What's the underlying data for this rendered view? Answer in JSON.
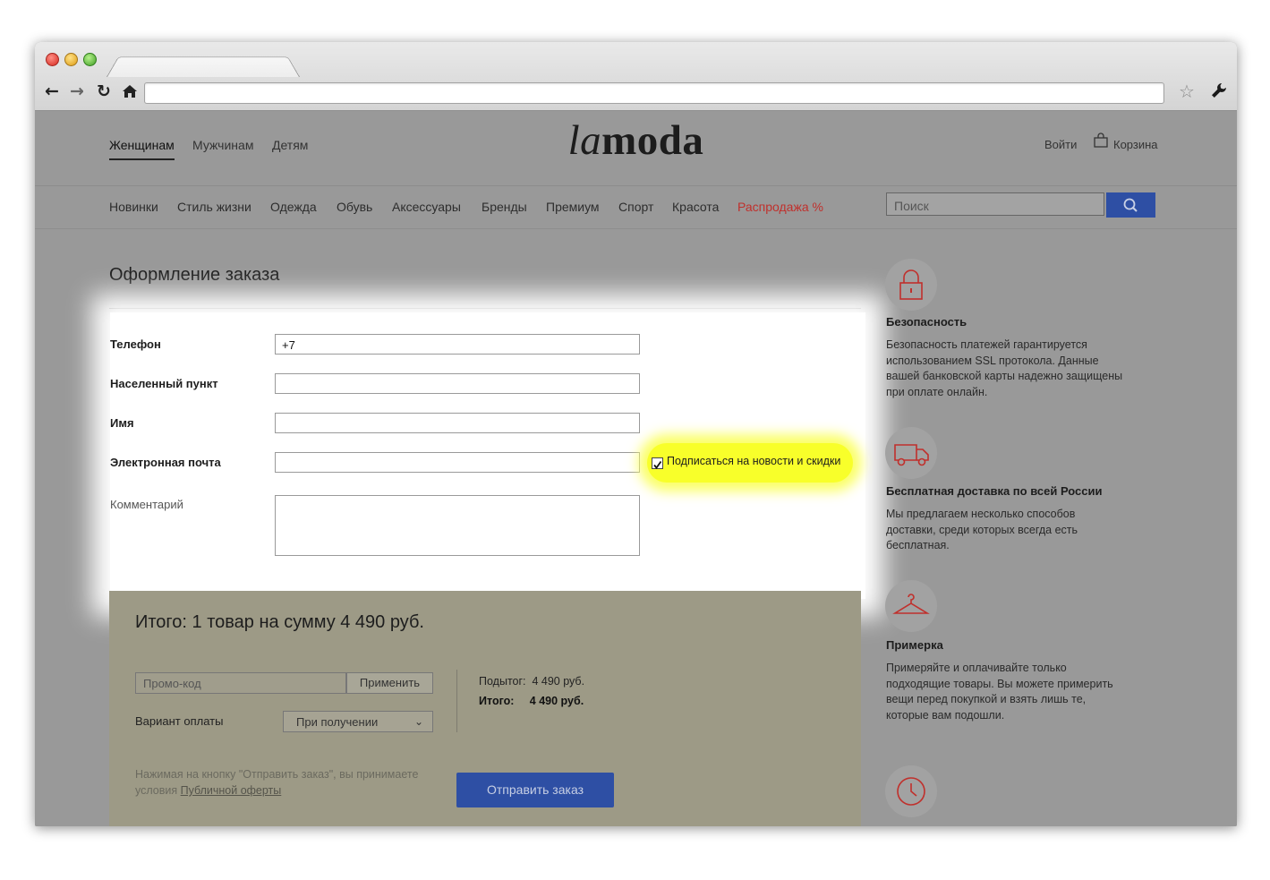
{
  "site": {
    "logo_part1": "la",
    "logo_part2": "moda",
    "top_nav": [
      "Женщинам",
      "Мужчинам",
      "Детям"
    ],
    "login_label": "Войти",
    "cart_label": "Корзина",
    "categories": [
      "Новинки",
      "Стиль жизни",
      "Одежда",
      "Обувь",
      "Аксессуары",
      "Бренды",
      "Премиум",
      "Спорт",
      "Красота",
      "Распродажа %"
    ],
    "search_placeholder": "Поиск",
    "sale_color": "#c0302c",
    "accent_color": "#2e4fa4"
  },
  "checkout": {
    "title": "Оформление заказа",
    "fields": {
      "phone_label": "Телефон",
      "phone_value": "+7",
      "city_label": "Населенный пункт",
      "name_label": "Имя",
      "email_label": "Электронная почта",
      "comment_label": "Комментарий"
    },
    "subscribe_label": "Подписаться на новости и скидки",
    "subscribe_checked": true
  },
  "summary": {
    "total_text": "Итого: 1 товар на сумму 4 490 руб.",
    "promo_placeholder": "Промо-код",
    "apply_label": "Применить",
    "payment_label": "Вариант оплаты",
    "payment_value": "При получении",
    "subtotal_label": "Подытог:",
    "subtotal_value": "4 490 руб.",
    "total_label": "Итого:",
    "total_value": "4 490 руб.",
    "terms_text": "Нажимая на кнопку \"Отправить заказ\", вы принимаете условия",
    "terms_link": "Публичной оферты",
    "submit_label": "Отправить заказ"
  },
  "sidebar": [
    {
      "icon": "lock-icon",
      "title": "Безопасность",
      "text": "Безопасность платежей гарантируется использованием SSL протокола. Данные вашей банковской карты надежно защищены при оплате онлайн."
    },
    {
      "icon": "truck-icon",
      "title": "Бесплатная доставка по всей России",
      "text": "Мы предлагаем несколько способов доставки, среди которых всегда есть бесплатная."
    },
    {
      "icon": "hanger-icon",
      "title": "Примерка",
      "text": "Примеряйте и оплачивайте только подходящие товары. Вы можете примерить вещи перед покупкой и взять лишь те, которые вам подошли."
    },
    {
      "icon": "clock-icon",
      "title": "",
      "text": ""
    }
  ]
}
